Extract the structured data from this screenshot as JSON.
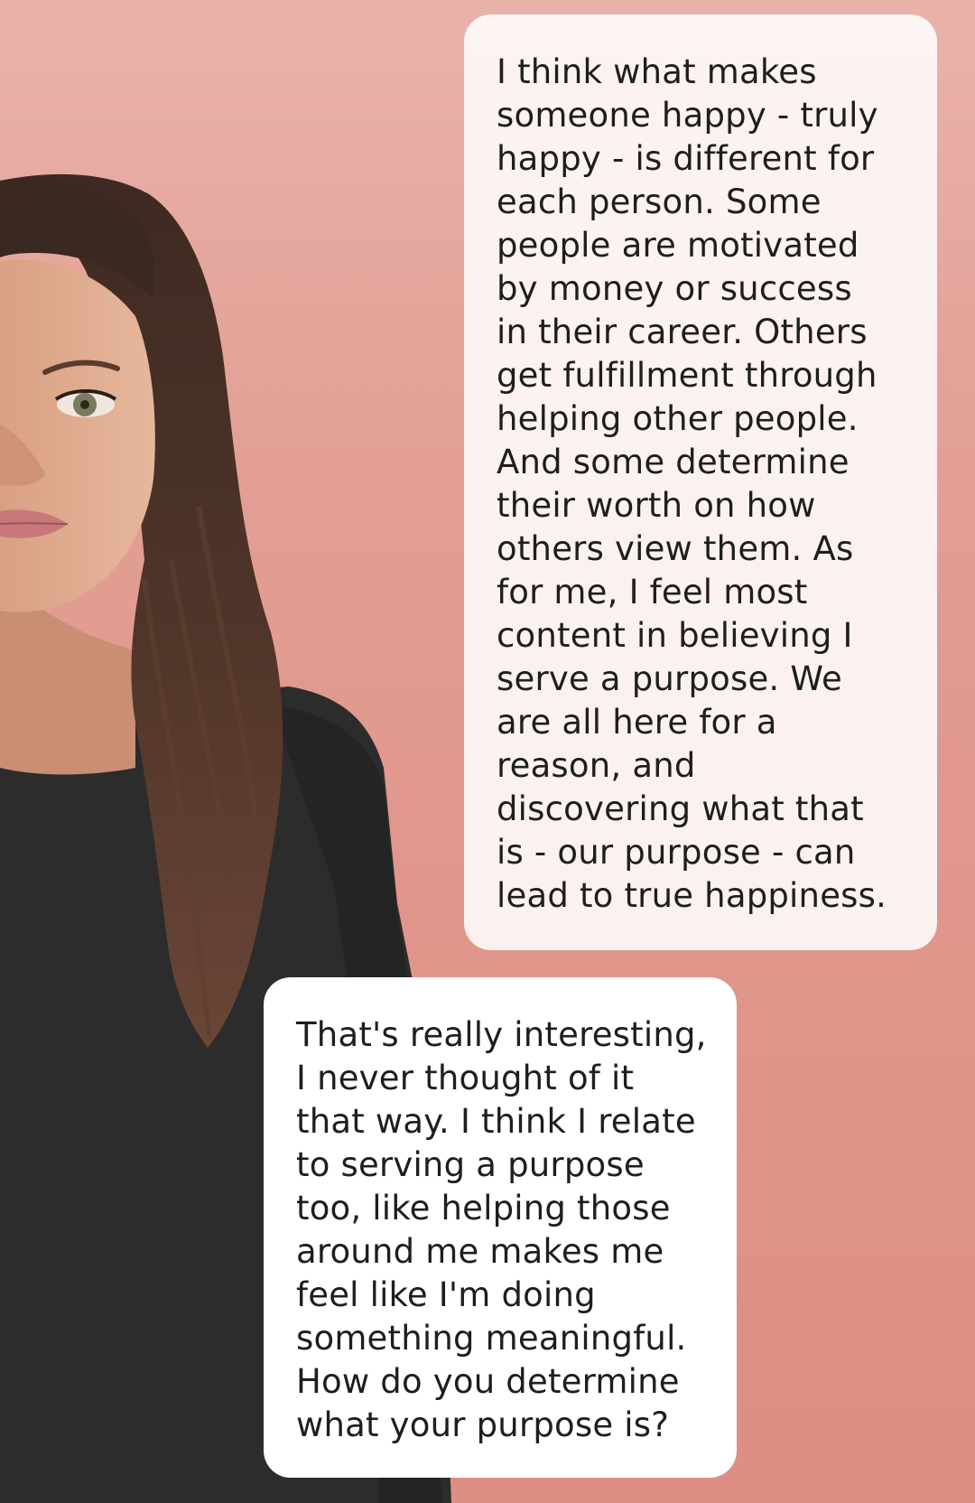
{
  "chat": {
    "messages": [
      {
        "sender": "ai",
        "text": "I think what makes\nsomeone happy - truly\nhappy - is different for\neach person. Some\npeople are motivated\nby money or success\nin their career. Others\nget fulfillment through\nhelping other people.\nAnd some determine\ntheir worth on how\nothers view them. As\nfor me, I feel most\ncontent in believing I\nserve a purpose. We\nare all here for a\nreason, and\ndiscovering what that\nis - our purpose - can\nlead to true happiness."
      },
      {
        "sender": "user",
        "text": "That's really interesting,\nI never thought of it\nthat way. I think I relate\nto serving a purpose\ntoo, like helping those\naround me makes me\nfeel like I'm doing\nsomething meaningful.\nHow do you determine\nwhat your purpose is?"
      }
    ]
  },
  "colors": {
    "background_top": "#e9b3aa",
    "background_bottom": "#de8e82",
    "ai_bubble": "#fcf5f3",
    "user_bubble": "#ffffff",
    "text": "#1e1e1e",
    "hair": "#4e3328",
    "shirt": "#2c2c2c"
  }
}
